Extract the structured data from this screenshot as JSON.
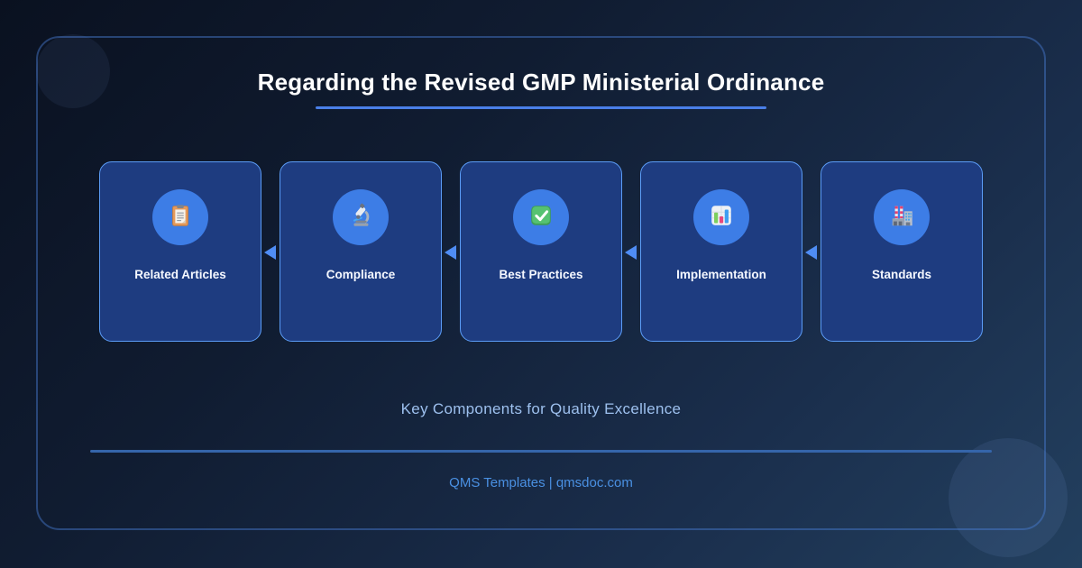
{
  "header": {
    "title": "Regarding the Revised GMP Ministerial Ordinance"
  },
  "cards": [
    {
      "label": "Related Articles",
      "icon": "clipboard-icon"
    },
    {
      "label": "Compliance",
      "icon": "microscope-icon"
    },
    {
      "label": "Best Practices",
      "icon": "check-mark-icon"
    },
    {
      "label": "Implementation",
      "icon": "bar-chart-icon"
    },
    {
      "label": "Standards",
      "icon": "factory-icon"
    }
  ],
  "arrows": {
    "direction": "left",
    "count": 4
  },
  "subtitle": "Key Components for Quality Excellence",
  "footer": {
    "credit": "QMS Templates | qmsdoc.com"
  },
  "theme": {
    "background_dark": "#0a1120",
    "background_light": "#23405f",
    "card_background": "#1e3c80",
    "card_border": "#5b9cf6",
    "icon_circle": "#3d7de6",
    "title_color": "#ffffff",
    "accent_underline": "#4a7fe8",
    "arrow_color": "#4f8df5",
    "subtitle_color": "#9dc0ee",
    "divider_color": "#3565aa",
    "footer_color": "#4a90e2"
  }
}
